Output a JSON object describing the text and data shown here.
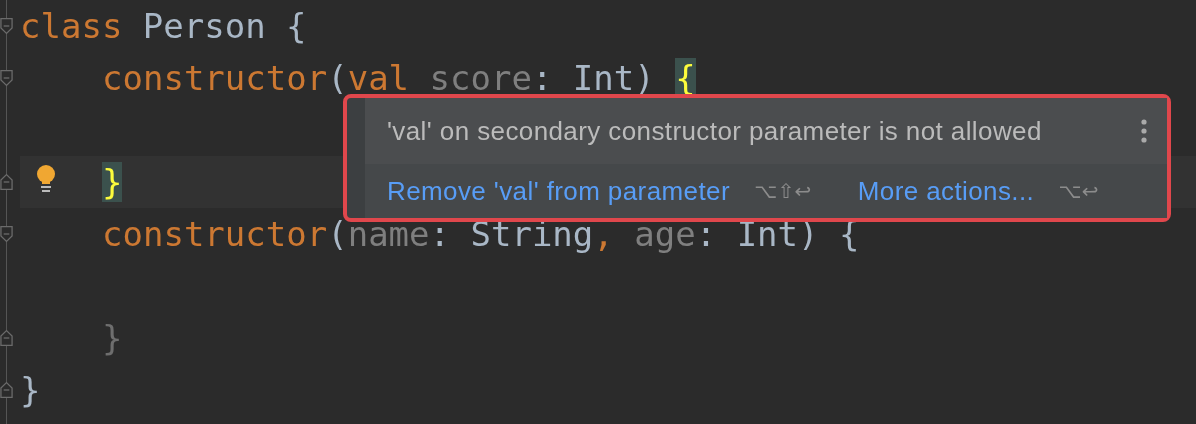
{
  "editor": {
    "lines": [
      {
        "gutter": [
          {
            "kind": "fold-start"
          }
        ],
        "tokens": [
          {
            "text": "class",
            "kind": "keyword"
          },
          {
            "text": " Person {",
            "kind": "plain"
          }
        ],
        "children": [
          {
            "gutter": [
              {
                "kind": "fold-start"
              }
            ],
            "tokens": [
              {
                "text": "constructor",
                "kind": "keyword"
              },
              {
                "text": "(",
                "kind": "plain"
              },
              {
                "text": "val",
                "kind": "error"
              },
              {
                "text": " score",
                "kind": "unused"
              },
              {
                "text": ": Int) ",
                "kind": "plain"
              },
              {
                "text": "{",
                "kind": "brace-match"
              }
            ],
            "children": [
              {
                "kind": "blank"
              }
            ]
          },
          {
            "gutter": [
              {
                "kind": "fold-end"
              },
              {
                "kind": "bulb"
              }
            ],
            "tokens": [
              {
                "text": "}",
                "kind": "brace-match"
              }
            ]
          },
          {
            "gutter": [
              {
                "kind": "fold-start"
              }
            ],
            "tokens": [
              {
                "text": "constructor",
                "kind": "keyword"
              },
              {
                "text": "(",
                "kind": "plain"
              },
              {
                "text": "name",
                "kind": "unused"
              },
              {
                "text": ": String",
                "kind": "plain"
              },
              {
                "text": ",",
                "kind": "keyword"
              },
              {
                "text": " age",
                "kind": "unused"
              },
              {
                "text": ": Int) {",
                "kind": "plain"
              }
            ],
            "children": [
              {
                "kind": "blank"
              }
            ]
          },
          {
            "gutter": [
              {
                "kind": "fold-end"
              }
            ],
            "tokens": [
              {
                "text": "}",
                "kind": "dim"
              }
            ]
          }
        ]
      },
      {
        "gutter": [
          {
            "kind": "fold-end"
          }
        ],
        "tokens": [
          {
            "text": "}",
            "kind": "plain"
          }
        ]
      }
    ]
  },
  "popup": {
    "message": "'val' on secondary constructor parameter is not allowed",
    "actions": [
      {
        "label": "Remove 'val' from parameter",
        "shortcut": "⌥⇧↩"
      },
      {
        "label": "More actions...",
        "shortcut": "⌥↩"
      }
    ]
  }
}
